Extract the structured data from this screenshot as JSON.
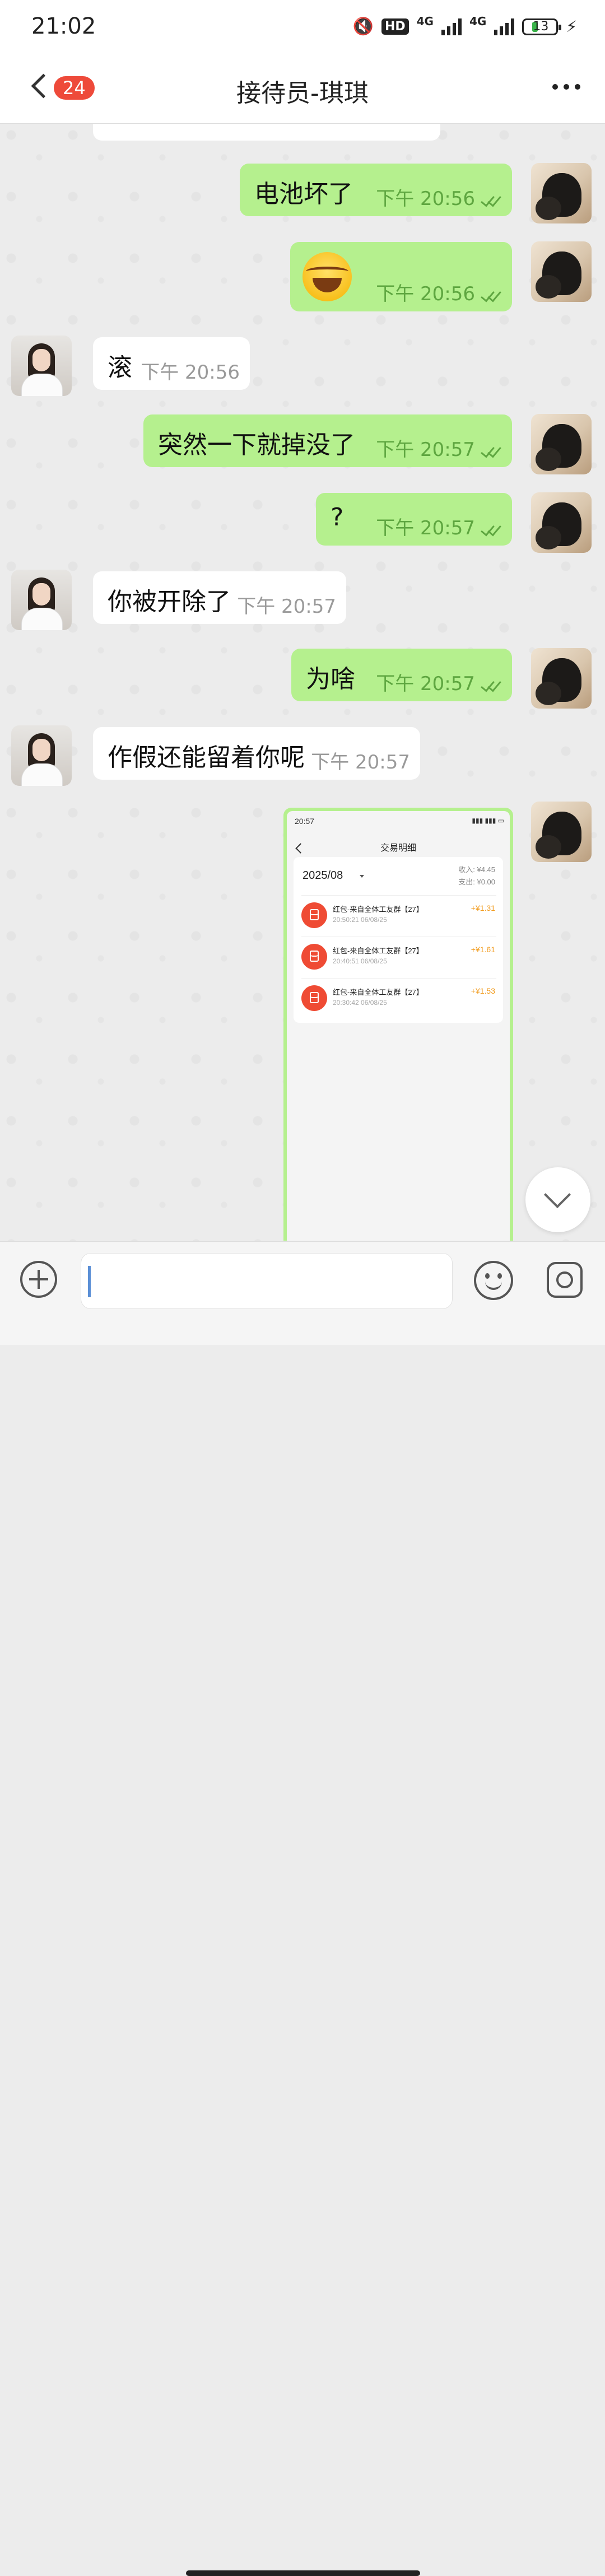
{
  "status_bar": {
    "time": "21:02",
    "network_left": "4G",
    "network_right": "4G",
    "battery": "13",
    "hd_badge": "HD"
  },
  "header": {
    "back_count": "24",
    "title": "接待员-琪琪"
  },
  "messages": [
    {
      "direction": "out",
      "text": "电池坏了",
      "period": "下午",
      "time": "20:56",
      "read": true
    },
    {
      "direction": "out",
      "emoji": "tears-of-joy",
      "period": "下午",
      "time": "20:56",
      "read": true
    },
    {
      "direction": "in",
      "text": "滚",
      "period": "下午",
      "time": "20:56"
    },
    {
      "direction": "out",
      "text": "突然一下就掉没了",
      "period": "下午",
      "time": "20:57",
      "read": true
    },
    {
      "direction": "out",
      "text": "?",
      "period": "下午",
      "time": "20:57",
      "read": true
    },
    {
      "direction": "in",
      "text": "你被开除了",
      "period": "下午",
      "time": "20:57"
    },
    {
      "direction": "out",
      "text": "为啥",
      "period": "下午",
      "time": "20:57",
      "read": true
    },
    {
      "direction": "in",
      "text": "作假还能留着你呢",
      "period": "下午",
      "time": "20:57"
    }
  ],
  "screenshot": {
    "time": "20:57",
    "title": "交易明细",
    "month": "2025/08",
    "income": "收入: ¥4.45",
    "expense": "支出: ¥0.00",
    "rows": [
      {
        "name": "红包-来自全体工友群【27】",
        "time": "20:50:21 06/08/25",
        "amount": "+¥1.31"
      },
      {
        "name": "红包-来自全体工友群【27】",
        "time": "20:40:51 06/08/25",
        "amount": "+¥1.61"
      },
      {
        "name": "红包-来自全体工友群【27】",
        "time": "20:30:42 06/08/25",
        "amount": "+¥1.53"
      }
    ]
  },
  "colors": {
    "outgoing_bubble": "#b5f08e",
    "incoming_bubble": "#ffffff",
    "badge": "#ee4a3a",
    "amount": "#f19a1b"
  }
}
